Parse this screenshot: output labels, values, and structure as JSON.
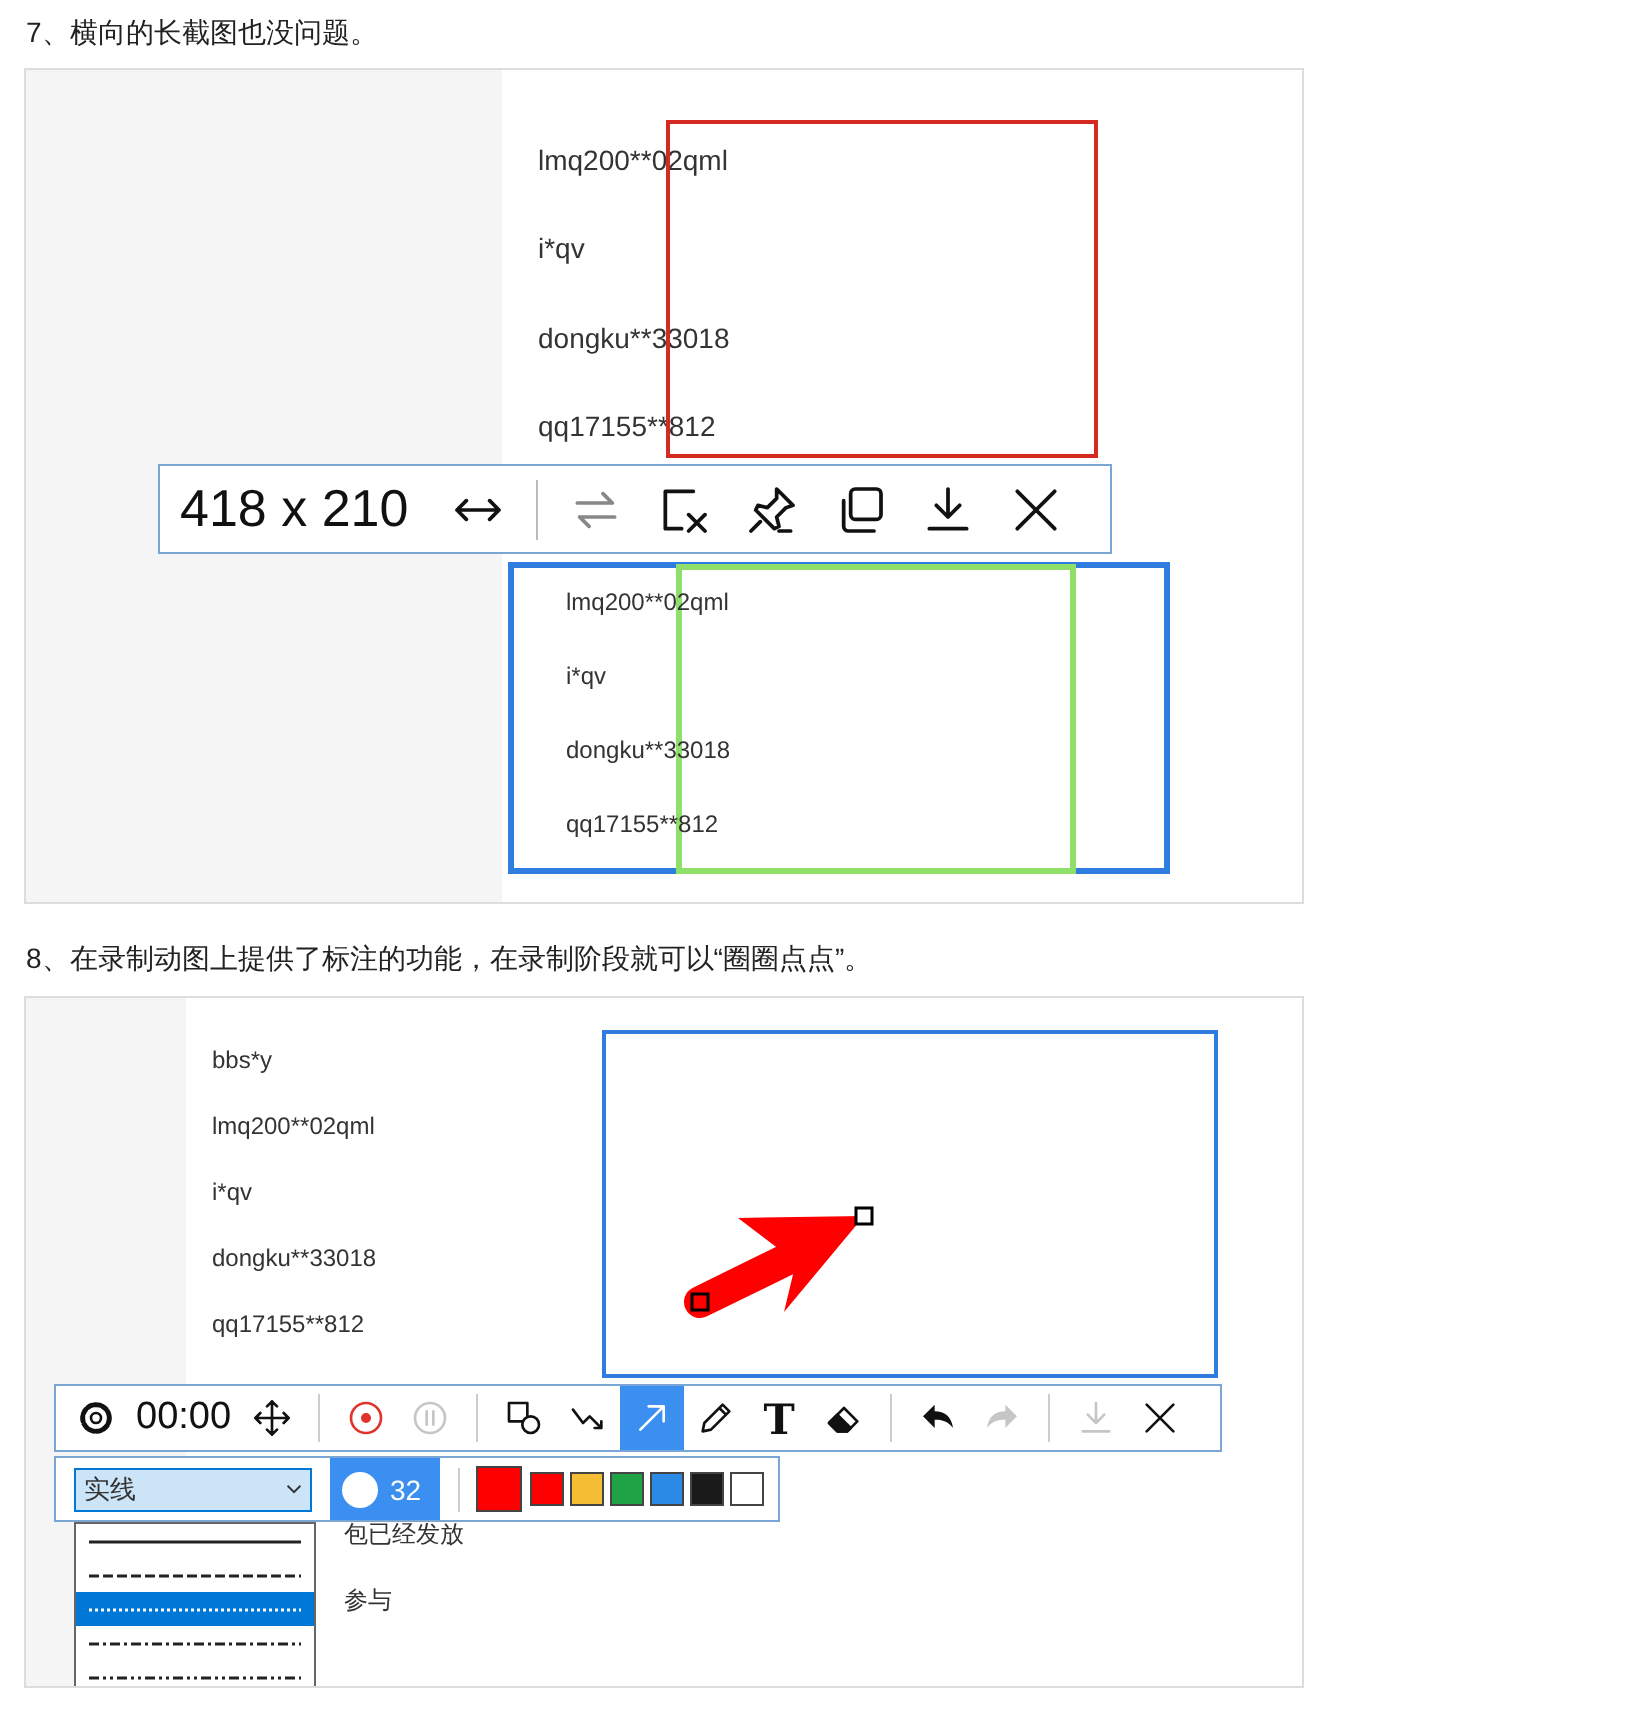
{
  "section_1": {
    "heading": "7、横向的长截图也没问题。",
    "screenshot": {
      "list_items": [
        "lmq200**02qml",
        "i*qv",
        "dongku**33018",
        "qq17155**812"
      ],
      "toolbar": {
        "size_label": "418 x 210",
        "tools": [
          {
            "kind": "expand",
            "disabled": false
          },
          {
            "kind": "separator"
          },
          {
            "kind": "swap",
            "disabled": true
          },
          {
            "kind": "cancel",
            "disabled": false
          },
          {
            "kind": "pin",
            "disabled": false
          },
          {
            "kind": "copy",
            "disabled": false
          },
          {
            "kind": "download",
            "disabled": false
          },
          {
            "kind": "close",
            "disabled": false
          }
        ]
      },
      "preview_items": [
        "lmq200**02qml",
        "i*qv",
        "dongku**33018",
        "qq17155**812"
      ]
    }
  },
  "section_2": {
    "heading": "8、在录制动图上提供了标注的功能，在录制阶段就可以“圈圈点点”。",
    "screenshot": {
      "list_items": [
        "bbs*y",
        "lmq200**02qml",
        "i*qv",
        "dongku**33018",
        "qq17155**812"
      ],
      "covered_items": [
        "包已经发放",
        "参与"
      ],
      "toolbar": [
        {
          "kind": "gear",
          "selected": false,
          "disabled": false
        },
        {
          "kind": "timer",
          "text": "00:00"
        },
        {
          "kind": "move",
          "selected": false,
          "disabled": false
        },
        {
          "kind": "separator"
        },
        {
          "kind": "record",
          "selected": false,
          "disabled": false
        },
        {
          "kind": "pause",
          "selected": false,
          "disabled": true
        },
        {
          "kind": "separator"
        },
        {
          "kind": "shape",
          "selected": false,
          "disabled": false
        },
        {
          "kind": "polyline",
          "selected": false,
          "disabled": false
        },
        {
          "kind": "arrow",
          "selected": true,
          "disabled": false
        },
        {
          "kind": "pencil",
          "selected": false,
          "disabled": false
        },
        {
          "kind": "text",
          "text": "T",
          "selected": false,
          "disabled": false
        },
        {
          "kind": "eraser",
          "selected": false,
          "disabled": false
        },
        {
          "kind": "separator"
        },
        {
          "kind": "undo",
          "selected": false,
          "disabled": false
        },
        {
          "kind": "redo",
          "selected": false,
          "disabled": true
        },
        {
          "kind": "separator"
        },
        {
          "kind": "download",
          "selected": false,
          "disabled": true
        },
        {
          "kind": "close",
          "selected": false,
          "disabled": false
        }
      ],
      "line_style": {
        "value": "实线",
        "options": [
          {
            "kind": "solid",
            "selected": false
          },
          {
            "kind": "dashed",
            "selected": false
          },
          {
            "kind": "dotted",
            "selected": true
          },
          {
            "kind": "dashdot",
            "selected": false
          },
          {
            "kind": "dashdotdot",
            "selected": false
          }
        ]
      },
      "pen_size": "32",
      "swatches": [
        {
          "kind": "current",
          "color": "#ff0000"
        },
        {
          "kind": "swatch",
          "color": "#ff0000"
        },
        {
          "kind": "swatch",
          "color": "#f4bd33"
        },
        {
          "kind": "swatch",
          "color": "#1ea446"
        },
        {
          "kind": "swatch",
          "color": "#2a8ae6"
        },
        {
          "kind": "swatch",
          "color": "#1a1a1a"
        },
        {
          "kind": "swatch",
          "color": "#ffffff"
        }
      ]
    }
  }
}
